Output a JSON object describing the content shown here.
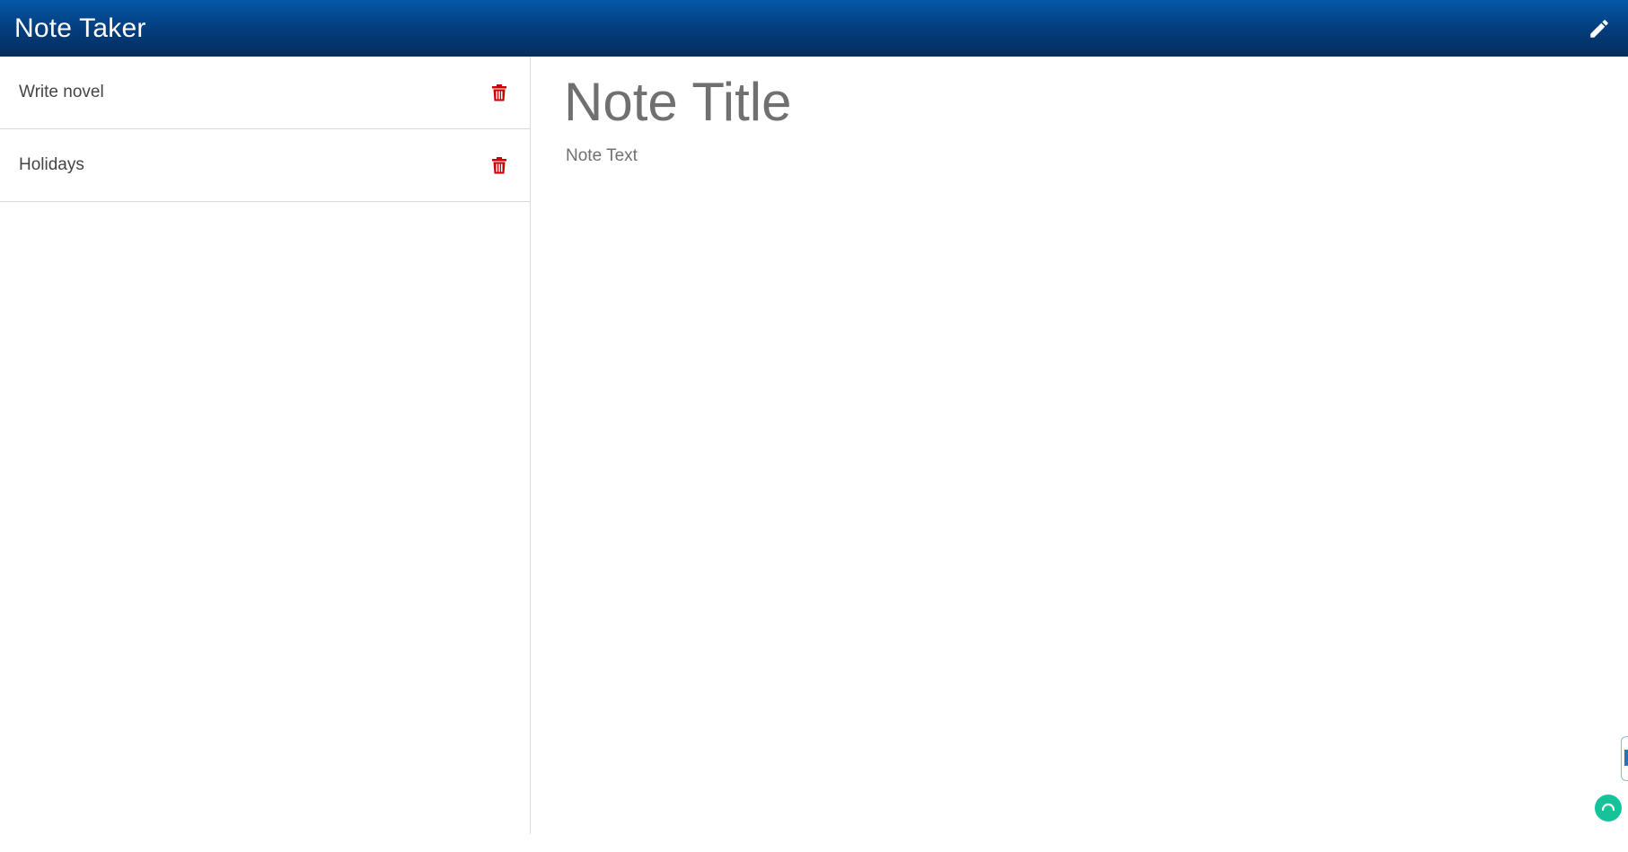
{
  "navbar": {
    "brand": "Note Taker",
    "new_note_icon": "pencil-icon",
    "background": "#043c7a"
  },
  "notes": [
    {
      "title": "Write novel",
      "delete_icon": "trash-icon"
    },
    {
      "title": "Holidays",
      "delete_icon": "trash-icon"
    }
  ],
  "editor": {
    "title_placeholder": "Note Title",
    "text_placeholder": "Note Text"
  },
  "colors": {
    "delete": "#cc0000",
    "assist": "#15c39a"
  }
}
